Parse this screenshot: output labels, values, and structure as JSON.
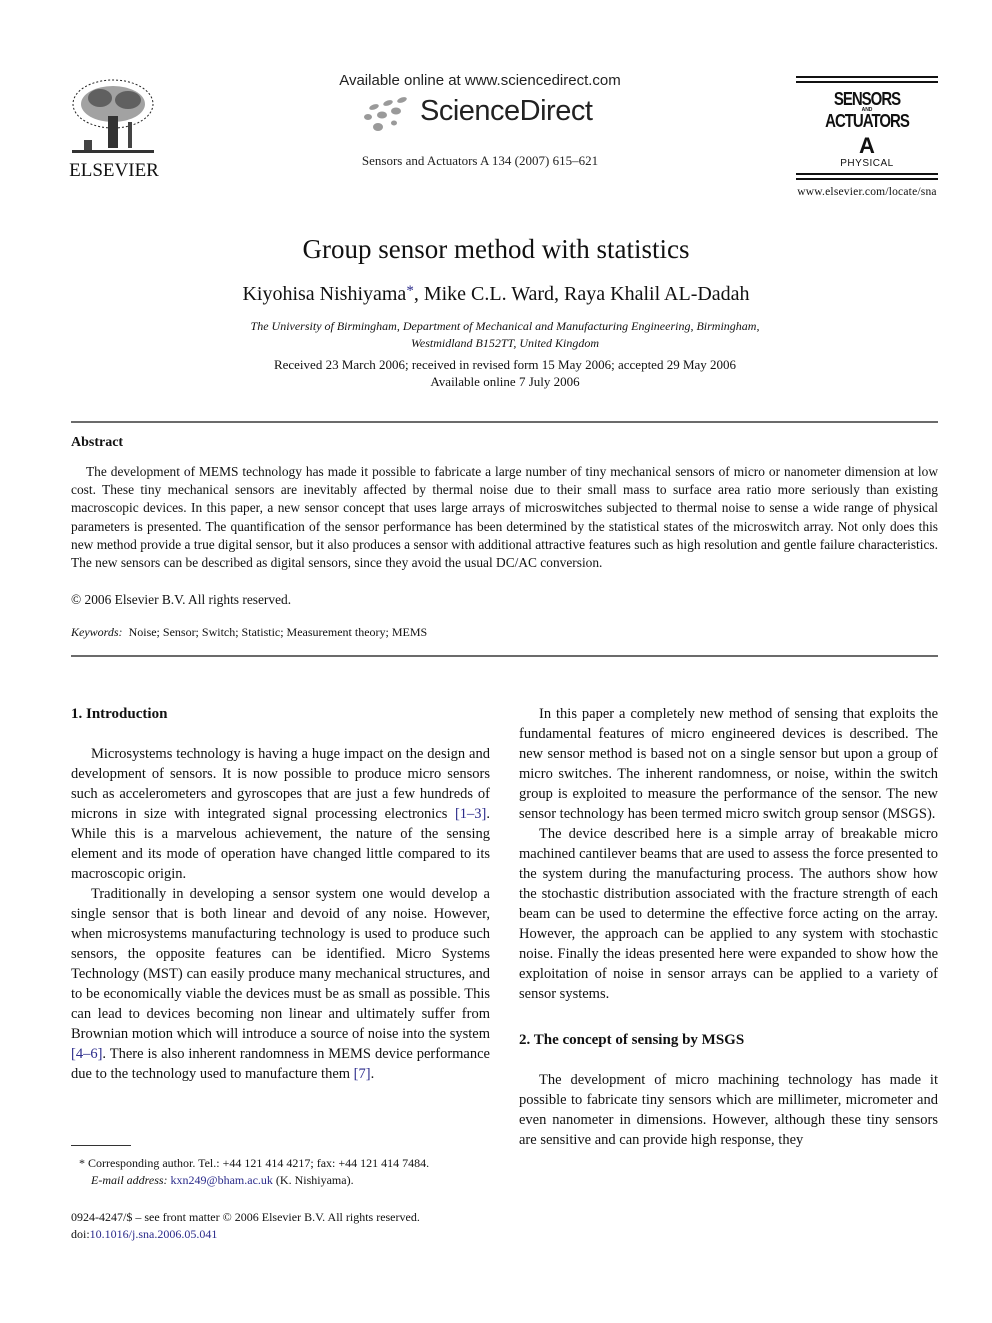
{
  "header": {
    "publisher": "ELSEVIER",
    "available_online": "Available online at www.sciencedirect.com",
    "sciencedirect": "ScienceDirect",
    "journal_ref": "Sensors and Actuators A 134 (2007) 615–621",
    "journal_logo": {
      "line1": "SENSORS",
      "line_small": "AND",
      "line2": "ACTUATORS",
      "letter": "A",
      "section": "PHYSICAL"
    },
    "journal_url": "www.elsevier.com/locate/sna"
  },
  "article": {
    "title": "Group sensor method with statistics",
    "authors": [
      {
        "name": "Kiyohisa Nishiyama",
        "mark": "*",
        "sep": ", "
      },
      {
        "name": "Mike C.L. Ward",
        "mark": "",
        "sep": ", "
      },
      {
        "name": "Raya Khalil AL-Dadah",
        "mark": "",
        "sep": ""
      }
    ],
    "affiliation_line1": "The University of Birmingham, Department of Mechanical and Manufacturing Engineering, Birmingham,",
    "affiliation_line2": "Westmidland B152TT, United Kingdom",
    "dates_line1": "Received 23 March 2006; received in revised form 15 May 2006; accepted 29 May 2006",
    "dates_line2": "Available online 7 July 2006"
  },
  "abstract": {
    "heading": "Abstract",
    "text": "The development of MEMS technology has made it possible to fabricate a large number of tiny mechanical sensors of micro or nanometer dimension at low cost. These tiny mechanical sensors are inevitably affected by thermal noise due to their small mass to surface area ratio more seriously than existing macroscopic devices. In this paper, a new sensor concept that uses large arrays of microswitches subjected to thermal noise to sense a wide range of physical parameters is presented. The quantification of the sensor performance has been determined by the statistical states of the microswitch array. Not only does this new method provide a true digital sensor, but it also produces a sensor with additional attractive features such as high resolution and gentle failure characteristics. The new sensors can be described as digital sensors, since they avoid the usual DC/AC conversion.",
    "copyright": "© 2006 Elsevier B.V. All rights reserved.",
    "keywords_label": "Keywords:",
    "keywords": "Noise; Sensor; Switch; Statistic; Measurement theory; MEMS"
  },
  "sections": {
    "intro_heading": "1.  Introduction",
    "intro_p1_a": "Microsystems technology is having a huge impact on the design and development of sensors. It is now possible to produce micro sensors such as accelerometers and gyroscopes that are just a few hundreds of microns in size with integrated signal processing electronics ",
    "intro_p1_ref": "[1–3]",
    "intro_p1_b": ". While this is a marvelous achievement, the nature of the sensing element and its mode of operation have changed little compared to its macroscopic origin.",
    "intro_p2_a": "Traditionally in developing a sensor system one would develop a single sensor that is both linear and devoid of any noise. However, when microsystems manufacturing technology is used to produce such sensors, the opposite features can be identified. Micro Systems Technology (MST) can easily produce many mechanical structures, and to be economically viable the devices must be as small as possible. This can lead to devices becoming non linear and ultimately suffer from Brownian motion which will introduce a source of noise into the system ",
    "intro_p2_ref1": "[4–6]",
    "intro_p2_b": ". There is also inherent randomness in MEMS device performance due to the technology used to manufacture them ",
    "intro_p2_ref2": "[7]",
    "intro_p2_c": ".",
    "right_p1": "In this paper a completely new method of sensing that exploits the fundamental features of micro engineered devices is described. The new sensor method is based not on a single sensor but upon a group of micro switches. The inherent randomness, or noise, within the switch group is exploited to measure the performance of the sensor. The new sensor technology has been termed micro switch group sensor (MSGS).",
    "right_p2": "The device described here is a simple array of breakable micro machined cantilever beams that are used to assess the force presented to the system during the manufacturing process. The authors show how the stochastic distribution associated with the fracture strength of each beam can be used to determine the effective force acting on the array. However, the approach can be applied to any system with stochastic noise. Finally the ideas presented here were expanded to show how the exploitation of noise in sensor arrays can be applied to a variety of sensor systems.",
    "sec2_heading": "2.  The concept of sensing by MSGS",
    "sec2_p1": "The development of micro machining technology has made it possible to fabricate tiny sensors which are millimeter, micrometer and even nanometer in dimensions. However, although these tiny sensors are sensitive and can provide high response, they"
  },
  "footnote": {
    "mark": "*",
    "contact": "Corresponding author. Tel.: +44 121 414 4217; fax: +44 121 414 7484.",
    "email_label": "E-mail address:",
    "email": "kxn249@bham.ac.uk",
    "email_owner": "(K. Nishiyama)."
  },
  "front_matter": {
    "issn_line": "0924-4247/$ – see front matter © 2006 Elsevier B.V. All rights reserved.",
    "doi_label": "doi:",
    "doi": "10.1016/j.sna.2006.05.041"
  },
  "colors": {
    "link": "#2a2a8a",
    "rule": "#6b6b6b"
  }
}
